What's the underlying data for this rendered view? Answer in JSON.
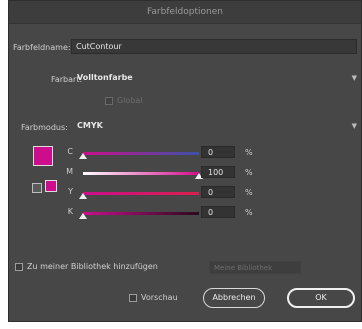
{
  "window": {
    "title": "Farbfeldoptionen"
  },
  "name": {
    "label": "Farbfeldname:",
    "value": "CutContour"
  },
  "colortype": {
    "label": "Farbart:",
    "value": "Volltonfarbe"
  },
  "global": {
    "label": "Global"
  },
  "colormode": {
    "label": "Farbmodus:",
    "value": "CMYK"
  },
  "swatch": {
    "color": "#cc0e8c"
  },
  "channels": [
    {
      "label": "C",
      "value": "0",
      "unit": "%",
      "level": 0
    },
    {
      "label": "M",
      "value": "100",
      "unit": "%",
      "level": 100
    },
    {
      "label": "Y",
      "value": "0",
      "unit": "%",
      "level": 0
    },
    {
      "label": "K",
      "value": "0",
      "unit": "%",
      "level": 0
    }
  ],
  "library": {
    "label": "Zu meiner Bibliothek hinzufügen",
    "dropdown": "Meine Bibliothek"
  },
  "preview": {
    "label": "Vorschau"
  },
  "buttons": {
    "cancel": "Abbrechen",
    "ok": "OK"
  }
}
